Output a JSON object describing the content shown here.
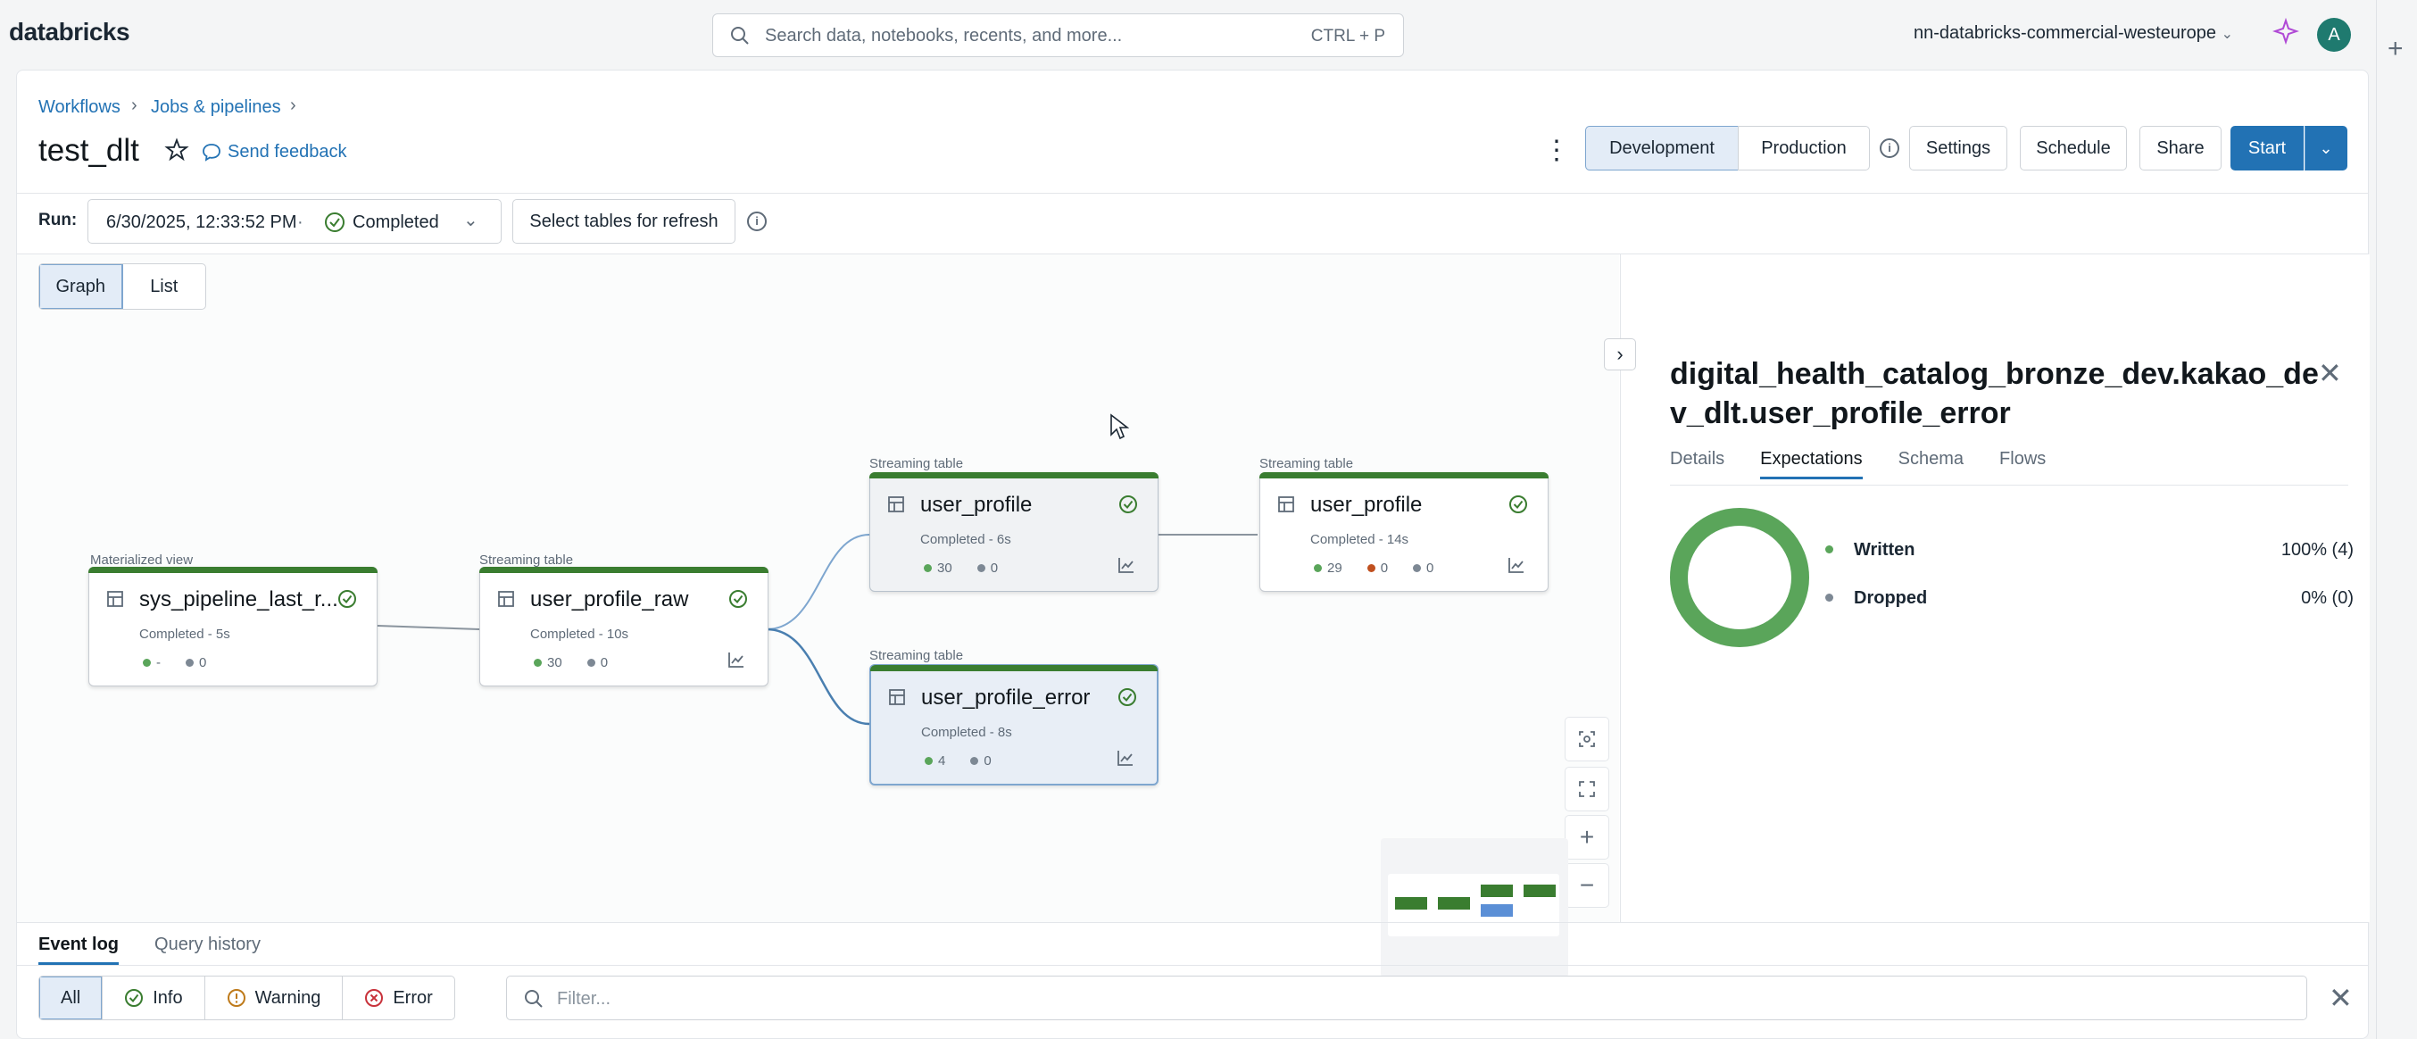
{
  "topbar": {
    "logo": "databricks",
    "search_placeholder": "Search data, notebooks, recents, and more...",
    "search_shortcut": "CTRL + P",
    "workspace": "nn-databricks-commercial-westeurope",
    "avatar_letter": "A"
  },
  "breadcrumb": [
    "Workflows",
    "Jobs & pipelines"
  ],
  "page": {
    "title": "test_dlt",
    "feedback": "Send feedback"
  },
  "header_actions": {
    "development": "Development",
    "production": "Production",
    "settings": "Settings",
    "schedule": "Schedule",
    "share": "Share",
    "start": "Start"
  },
  "run": {
    "label": "Run:",
    "datetime": "6/30/2025, 12:33:52 PM",
    "separator": "·",
    "status": "Completed",
    "select_tables": "Select tables for refresh"
  },
  "view_toggle": {
    "graph": "Graph",
    "list": "List"
  },
  "nodes": [
    {
      "type": "Materialized view",
      "name": "sys_pipeline_last_r...",
      "status": "Completed - 5s",
      "stats": [
        "-",
        "0"
      ]
    },
    {
      "type": "Streaming table",
      "name": "user_profile_raw",
      "status": "Completed - 10s",
      "stats": [
        "30",
        "0"
      ]
    },
    {
      "type": "Streaming table",
      "name": "user_profile",
      "status": "Completed - 6s",
      "stats": [
        "30",
        "0"
      ]
    },
    {
      "type": "Streaming table",
      "name": "user_profile_error",
      "status": "Completed - 8s",
      "stats": [
        "4",
        "0"
      ]
    },
    {
      "type": "Streaming table",
      "name": "user_profile",
      "status": "Completed - 14s",
      "stats": [
        "29",
        "0",
        "0"
      ]
    }
  ],
  "right_panel": {
    "title": "digital_health_catalog_bronze_dev.kakao_dev_dlt.user_profile_error",
    "tabs": [
      "Details",
      "Expectations",
      "Schema",
      "Flows"
    ],
    "active_tab": "Expectations",
    "legend": [
      {
        "label": "Written",
        "value": "100% (4)",
        "color": "#5aa55a"
      },
      {
        "label": "Dropped",
        "value": "0% (0)",
        "color": "#7d8894"
      }
    ],
    "written_fraction": 1.0
  },
  "bottom": {
    "tabs": [
      "Event log",
      "Query history"
    ],
    "filters": [
      "All",
      "Info",
      "Warning",
      "Error"
    ],
    "filter_placeholder": "Filter..."
  },
  "colors": {
    "accent": "#2272b4",
    "success": "#3a7d30",
    "error_dot": "#c0501f"
  }
}
